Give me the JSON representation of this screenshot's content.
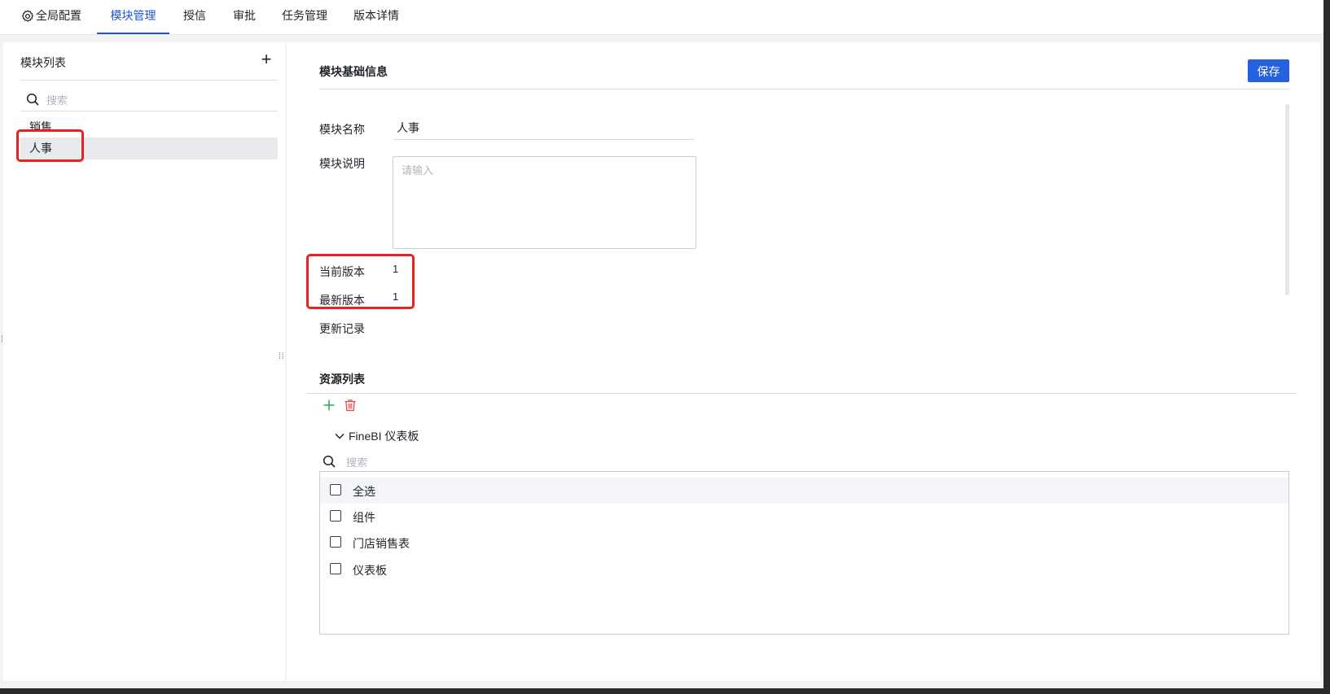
{
  "nav": {
    "tabs": [
      "全局配置",
      "模块管理",
      "授信",
      "审批",
      "任务管理",
      "版本详情"
    ],
    "active_tab": "模块管理"
  },
  "module_list": {
    "title": "模块列表",
    "add_icon": "plus-icon",
    "search_placeholder": "搜索",
    "items": [
      {
        "label": "销售",
        "selected": false
      },
      {
        "label": "人事",
        "selected": true
      }
    ]
  },
  "basic_info": {
    "title": "模块基础信息",
    "save_label": "保存",
    "name_label": "模块名称",
    "name_value": "人事",
    "desc_label": "模块说明",
    "desc_placeholder": "请输入",
    "current_version_label": "当前版本",
    "current_version_value": "1",
    "latest_version_label": "最新版本",
    "latest_version_value": "1",
    "update_log_label": "更新记录"
  },
  "resources": {
    "title": "资源列表",
    "add_icon": "plus-icon",
    "delete_icon": "trash-icon",
    "tree_node_label": "FineBI 仪表板",
    "search_placeholder": "搜索",
    "items": [
      {
        "label": "全选"
      },
      {
        "label": "组件"
      },
      {
        "label": "门店销售表"
      },
      {
        "label": "仪表板"
      }
    ]
  },
  "colors": {
    "accent": "#2055d4",
    "primary_button": "#2661e0",
    "highlight_box": "#e8231d",
    "add_green": "#2fa84f",
    "delete_red": "#e5484d"
  }
}
